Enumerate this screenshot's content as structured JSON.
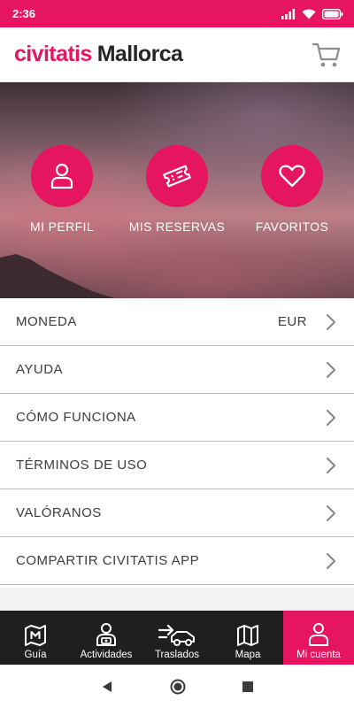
{
  "status_bar": {
    "time": "2:36"
  },
  "header": {
    "brand": "civitatis",
    "city": "Mallorca",
    "cart_icon": "shopping-cart-icon"
  },
  "quick_actions": [
    {
      "label": "MI PERFIL",
      "icon": "user-icon"
    },
    {
      "label": "MIS RESERVAS",
      "icon": "ticket-icon"
    },
    {
      "label": "FAVORITOS",
      "icon": "heart-icon"
    }
  ],
  "menu": [
    {
      "label": "MONEDA",
      "value": "EUR"
    },
    {
      "label": "AYUDA"
    },
    {
      "label": "CÓMO FUNCIONA"
    },
    {
      "label": "TÉRMINOS DE USO"
    },
    {
      "label": "VALÓRANOS"
    },
    {
      "label": "COMPARTIR CIVITATIS APP"
    }
  ],
  "bottom_nav": [
    {
      "label": "Guía",
      "icon": "guide-map-icon"
    },
    {
      "label": "Actividades",
      "icon": "activities-icon"
    },
    {
      "label": "Traslados",
      "icon": "transfer-car-icon"
    },
    {
      "label": "Mapa",
      "icon": "map-icon"
    },
    {
      "label": "Mi cuenta",
      "icon": "user-icon",
      "active": true
    }
  ],
  "colors": {
    "accent": "#e6155f",
    "nav_background": "#1f1f1f",
    "text": "#3c3c3c"
  }
}
